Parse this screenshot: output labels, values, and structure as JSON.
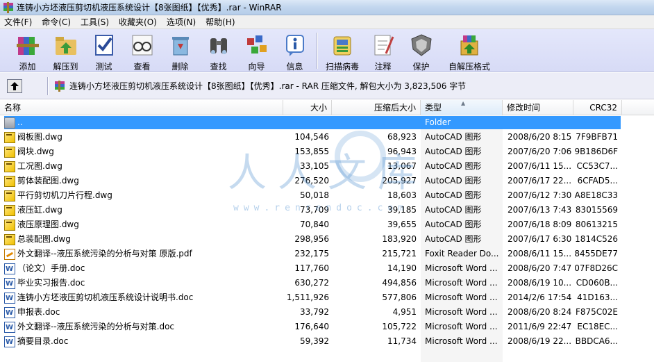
{
  "window": {
    "title": "连铸小方坯液压剪切机液压系统设计【8张图纸】【优秀】.rar - WinRAR"
  },
  "menu": [
    {
      "label": "文件(F)"
    },
    {
      "label": "命令(C)"
    },
    {
      "label": "工具(S)"
    },
    {
      "label": "收藏夹(O)"
    },
    {
      "label": "选项(N)"
    },
    {
      "label": "帮助(H)"
    }
  ],
  "toolbar": [
    {
      "label": "添加",
      "icon": "add-books-icon",
      "color": "#c94a4a"
    },
    {
      "label": "解压到",
      "icon": "extract-folder-icon",
      "color": "#6a9a3a"
    },
    {
      "label": "测试",
      "icon": "test-check-icon",
      "color": "#3a5aa8"
    },
    {
      "label": "查看",
      "icon": "view-glasses-icon",
      "color": "#7a7a7a"
    },
    {
      "label": "删除",
      "icon": "delete-recycle-icon",
      "color": "#5a8ab8"
    },
    {
      "label": "查找",
      "icon": "find-binoculars-icon",
      "color": "#4a4a4a"
    },
    {
      "label": "向导",
      "icon": "wizard-icon",
      "color": "#c05a5a"
    },
    {
      "label": "信息",
      "icon": "info-icon",
      "color": "#4a7ac8"
    },
    {
      "label": "扫描病毒",
      "icon": "virus-scan-icon",
      "color": "#d4a020"
    },
    {
      "label": "注释",
      "icon": "comment-icon",
      "color": "#8a8a8a"
    },
    {
      "label": "保护",
      "icon": "protect-shield-icon",
      "color": "#6a6a6a"
    },
    {
      "label": "自解压格式",
      "icon": "sfx-icon",
      "color": "#3a9a3a"
    }
  ],
  "address": {
    "up_label": "↑",
    "text": "连铸小方坯液压剪切机液压系统设计【8张图纸】【优秀】.rar - RAR 压缩文件, 解包大小为 3,823,506 字节"
  },
  "columns": {
    "name": "名称",
    "size": "大小",
    "packed": "压缩后大小",
    "type": "类型",
    "modified": "修改时间",
    "crc": "CRC32"
  },
  "files": [
    {
      "name": "..",
      "size": "",
      "packed": "",
      "type": "Folder",
      "modified": "",
      "crc": "",
      "icon": "folder",
      "selected": true
    },
    {
      "name": "阀板图.dwg",
      "size": "104,546",
      "packed": "68,923",
      "type": "AutoCAD 图形",
      "modified": "2008/6/20 8:15",
      "crc": "7F9BFB71",
      "icon": "dwg"
    },
    {
      "name": "阀块.dwg",
      "size": "153,855",
      "packed": "96,943",
      "type": "AutoCAD 图形",
      "modified": "2007/6/20 7:06",
      "crc": "9B186D6F",
      "icon": "dwg"
    },
    {
      "name": "工况图.dwg",
      "size": "33,105",
      "packed": "13,067",
      "type": "AutoCAD 图形",
      "modified": "2007/6/11 15...",
      "crc": "CC53C7...",
      "icon": "dwg"
    },
    {
      "name": "剪体装配图.dwg",
      "size": "276,520",
      "packed": "205,927",
      "type": "AutoCAD 图形",
      "modified": "2007/6/17 22...",
      "crc": "6CFAD5...",
      "icon": "dwg"
    },
    {
      "name": "平行剪切机刀片行程.dwg",
      "size": "50,018",
      "packed": "18,603",
      "type": "AutoCAD 图形",
      "modified": "2007/6/12 7:30",
      "crc": "A8E18C33",
      "icon": "dwg"
    },
    {
      "name": "液压缸.dwg",
      "size": "73,709",
      "packed": "39,185",
      "type": "AutoCAD 图形",
      "modified": "2007/6/13 7:43",
      "crc": "83015569",
      "icon": "dwg"
    },
    {
      "name": "液压原理图.dwg",
      "size": "70,840",
      "packed": "39,655",
      "type": "AutoCAD 图形",
      "modified": "2007/6/18 8:09",
      "crc": "80613215",
      "icon": "dwg"
    },
    {
      "name": "总装配图.dwg",
      "size": "298,956",
      "packed": "183,920",
      "type": "AutoCAD 图形",
      "modified": "2007/6/17 6:30",
      "crc": "1814C526",
      "icon": "dwg"
    },
    {
      "name": "外文翻译--液压系统污染的分析与对策  原版.pdf",
      "size": "232,175",
      "packed": "215,721",
      "type": "Foxit Reader Do...",
      "modified": "2008/6/11 15...",
      "crc": "8455DE77",
      "icon": "pdf"
    },
    {
      "name": "（论文）手册.doc",
      "size": "117,760",
      "packed": "14,190",
      "type": "Microsoft Word ...",
      "modified": "2008/6/20 7:47",
      "crc": "07F8D26C",
      "icon": "doc"
    },
    {
      "name": "毕业实习报告.doc",
      "size": "630,272",
      "packed": "494,856",
      "type": "Microsoft Word ...",
      "modified": "2008/6/19 10...",
      "crc": "CD060B...",
      "icon": "doc"
    },
    {
      "name": "连铸小方坯液压剪切机液压系统设计说明书.doc",
      "size": "1,511,926",
      "packed": "577,806",
      "type": "Microsoft Word ...",
      "modified": "2014/2/6 17:54",
      "crc": "41D163...",
      "icon": "doc"
    },
    {
      "name": "申报表.doc",
      "size": "33,792",
      "packed": "4,951",
      "type": "Microsoft Word ...",
      "modified": "2008/6/20 8:24",
      "crc": "F875C02E",
      "icon": "doc"
    },
    {
      "name": "外文翻译--液压系统污染的分析与对策.doc",
      "size": "176,640",
      "packed": "105,722",
      "type": "Microsoft Word ...",
      "modified": "2011/6/9 22:47",
      "crc": "EC18EC...",
      "icon": "doc"
    },
    {
      "name": "摘要目录.doc",
      "size": "59,392",
      "packed": "11,734",
      "type": "Microsoft Word ...",
      "modified": "2008/6/19 22...",
      "crc": "BBDCA6...",
      "icon": "doc"
    }
  ],
  "watermark": {
    "text": "人人文库",
    "url": "www.renrendoc.com"
  }
}
